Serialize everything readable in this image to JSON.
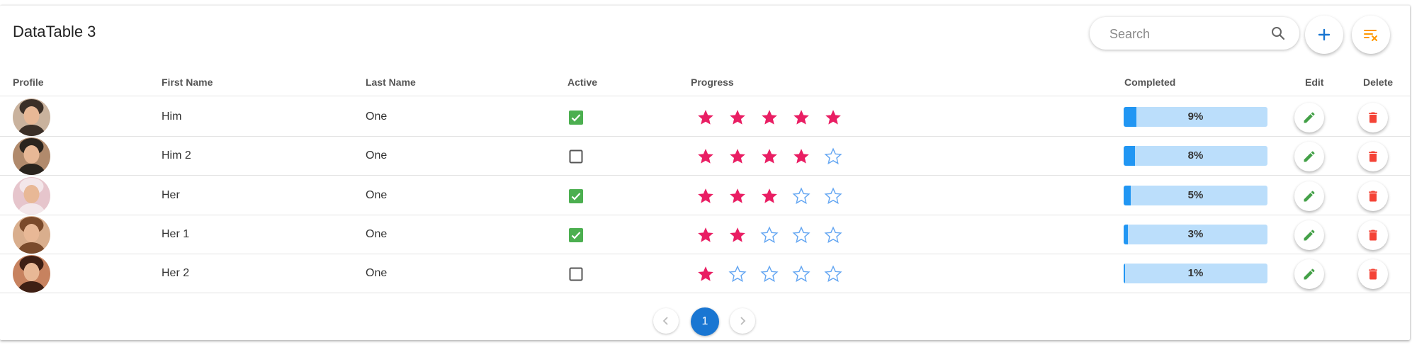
{
  "table": {
    "title": "DataTable 3",
    "search_placeholder": "Search",
    "search_icon": "search-icon",
    "add_icon": "plus-icon",
    "filter_icon": "clear-filter-icon",
    "colors": {
      "accent": "#1976d2",
      "star": "#e91e63",
      "star_empty": "#64a6f2",
      "check": "#4caf50",
      "edit": "#43a047",
      "delete": "#f44336",
      "filter": "#ff9800",
      "bar_fill": "#2196f3",
      "bar_bg": "#bbdefb"
    }
  },
  "columns": [
    "Profile",
    "First Name",
    "Last Name",
    "Active",
    "Progress",
    "Completed",
    "Edit",
    "Delete"
  ],
  "rows": [
    {
      "first": "Him",
      "last": "One",
      "active": true,
      "rating": 5,
      "completed": "9%",
      "completed_value": 9
    },
    {
      "first": "Him 2",
      "last": "One",
      "active": false,
      "rating": 4,
      "completed": "8%",
      "completed_value": 8
    },
    {
      "first": "Her",
      "last": "One",
      "active": true,
      "rating": 3,
      "completed": "5%",
      "completed_value": 5
    },
    {
      "first": "Her 1",
      "last": "One",
      "active": true,
      "rating": 2,
      "completed": "3%",
      "completed_value": 3
    },
    {
      "first": "Her 2",
      "last": "One",
      "active": false,
      "rating": 1,
      "completed": "1%",
      "completed_value": 1
    }
  ],
  "pagination": {
    "current": "1",
    "prev_icon": "chevron-left-icon",
    "next_icon": "chevron-right-icon"
  }
}
